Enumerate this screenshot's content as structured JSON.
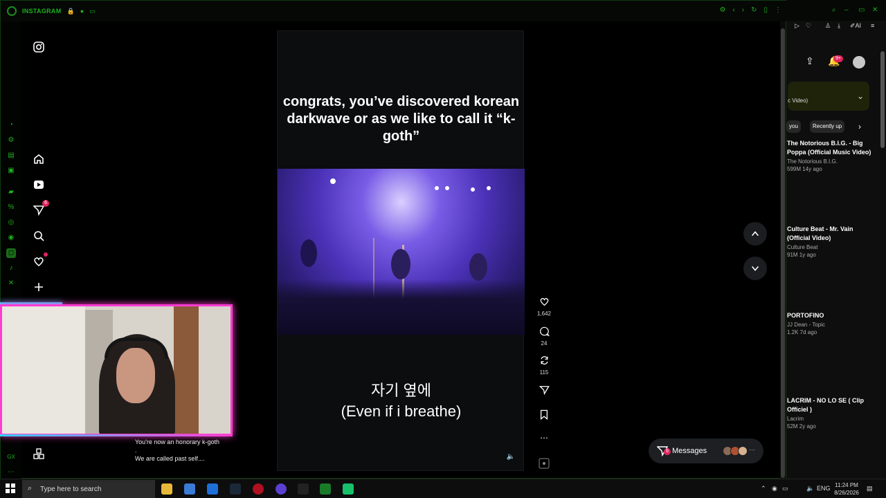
{
  "browser": {
    "tab_title": "INSTAGRAM"
  },
  "reel": {
    "caption_top": "congrats, you’ve discovered korean darkwave or as we like to call it “k-goth”",
    "caption_korean": "자기 옆에",
    "caption_english": "(Even if i breathe)",
    "likes": "1,642",
    "comments": "24",
    "reposts": "115"
  },
  "sidebar": {
    "notifications_badge": "6"
  },
  "messages": {
    "label": "Messages",
    "badge": "6",
    "more": "···"
  },
  "stream_chat": {
    "line1": "You're now an honorary k-goth",
    "line1b": ".",
    "line2": "We are called past self...."
  },
  "right_panel": {
    "notification_badge": "9+",
    "card_text": "c Video)",
    "chips": [
      "you",
      "Recently up"
    ],
    "videos": [
      {
        "title": "The Notorious B.I.G. - Big Poppa (Official Music Video)",
        "channel": "The Notorious B.I.G.",
        "meta": "599M  14y ago"
      },
      {
        "title": "Culture Beat - Mr. Vain (Official Video)",
        "channel": "Culture Beat",
        "meta": "91M  1y ago"
      },
      {
        "title": "PORTOFINO",
        "channel": "JJ Dean - Topic",
        "meta": "1.2K  7d ago"
      },
      {
        "title": "LACRIM - NO LO SE ( Clip Officiel )",
        "channel": "Lacrim",
        "meta": "52M  2y ago"
      }
    ]
  },
  "gx_label": "GX",
  "taskbar": {
    "search_placeholder": "Type here to search",
    "language": "ENG",
    "time": "11:24 PM",
    "date": "8/26/2026"
  }
}
